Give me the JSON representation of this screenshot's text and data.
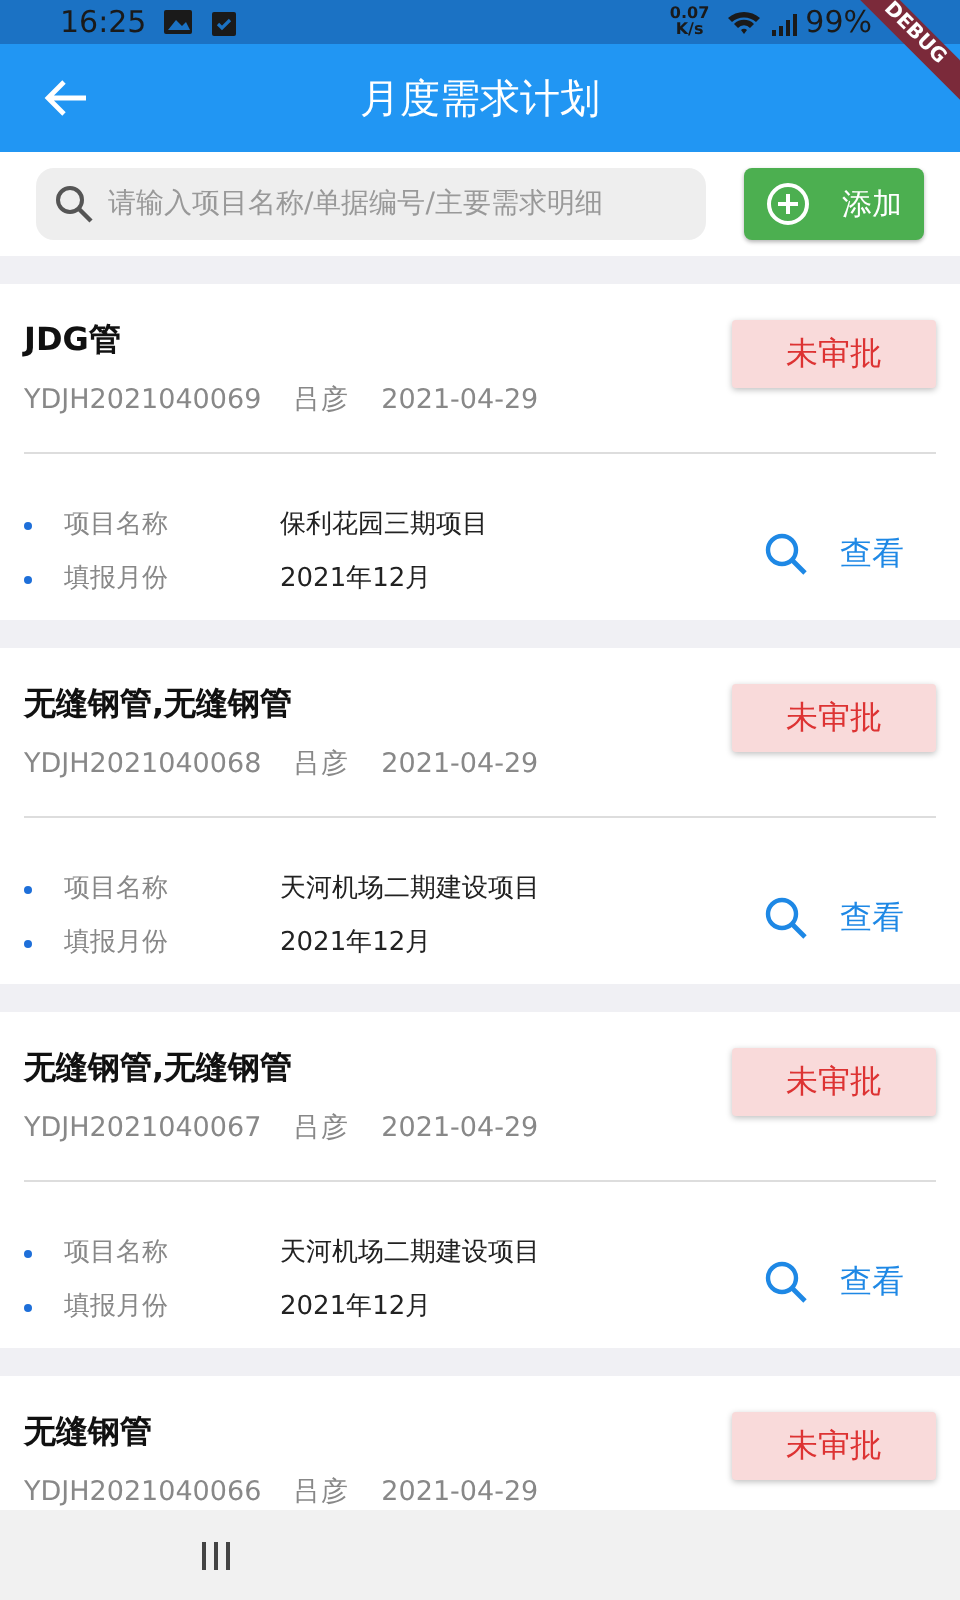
{
  "status_bar": {
    "time": "16:25",
    "net_speed": "0.07",
    "net_unit": "K/s",
    "battery": "99%"
  },
  "debug_banner": "DEBUG",
  "app_bar": {
    "title": "月度需求计划"
  },
  "search": {
    "placeholder": "请输入项目名称/单据编号/主要需求明细"
  },
  "add_button": "添加",
  "plans": [
    {
      "title": "JDG管",
      "code": "YDJH2021040069",
      "person": "吕彦",
      "date": "2021-04-29",
      "status": "未审批",
      "kind": "pending",
      "fields": [
        {
          "label": "项目名称",
          "value": "保利花园三期项目"
        },
        {
          "label": "填报月份",
          "value": "2021年12月"
        }
      ],
      "action": "查看"
    },
    {
      "title": "无缝钢管,无缝钢管",
      "code": "YDJH2021040068",
      "person": "吕彦",
      "date": "2021-04-29",
      "status": "未审批",
      "kind": "pending",
      "fields": [
        {
          "label": "项目名称",
          "value": "天河机场二期建设项目"
        },
        {
          "label": "填报月份",
          "value": "2021年12月"
        }
      ],
      "action": "查看"
    },
    {
      "title": "无缝钢管,无缝钢管",
      "code": "YDJH2021040067",
      "person": "吕彦",
      "date": "2021-04-29",
      "status": "未审批",
      "kind": "pending",
      "fields": [
        {
          "label": "项目名称",
          "value": "天河机场二期建设项目"
        },
        {
          "label": "填报月份",
          "value": "2021年12月"
        }
      ],
      "action": "查看"
    },
    {
      "title": "无缝钢管",
      "code": "YDJH2021040066",
      "person": "吕彦",
      "date": "2021-04-29",
      "status": "未审批",
      "kind": "pending"
    }
  ]
}
